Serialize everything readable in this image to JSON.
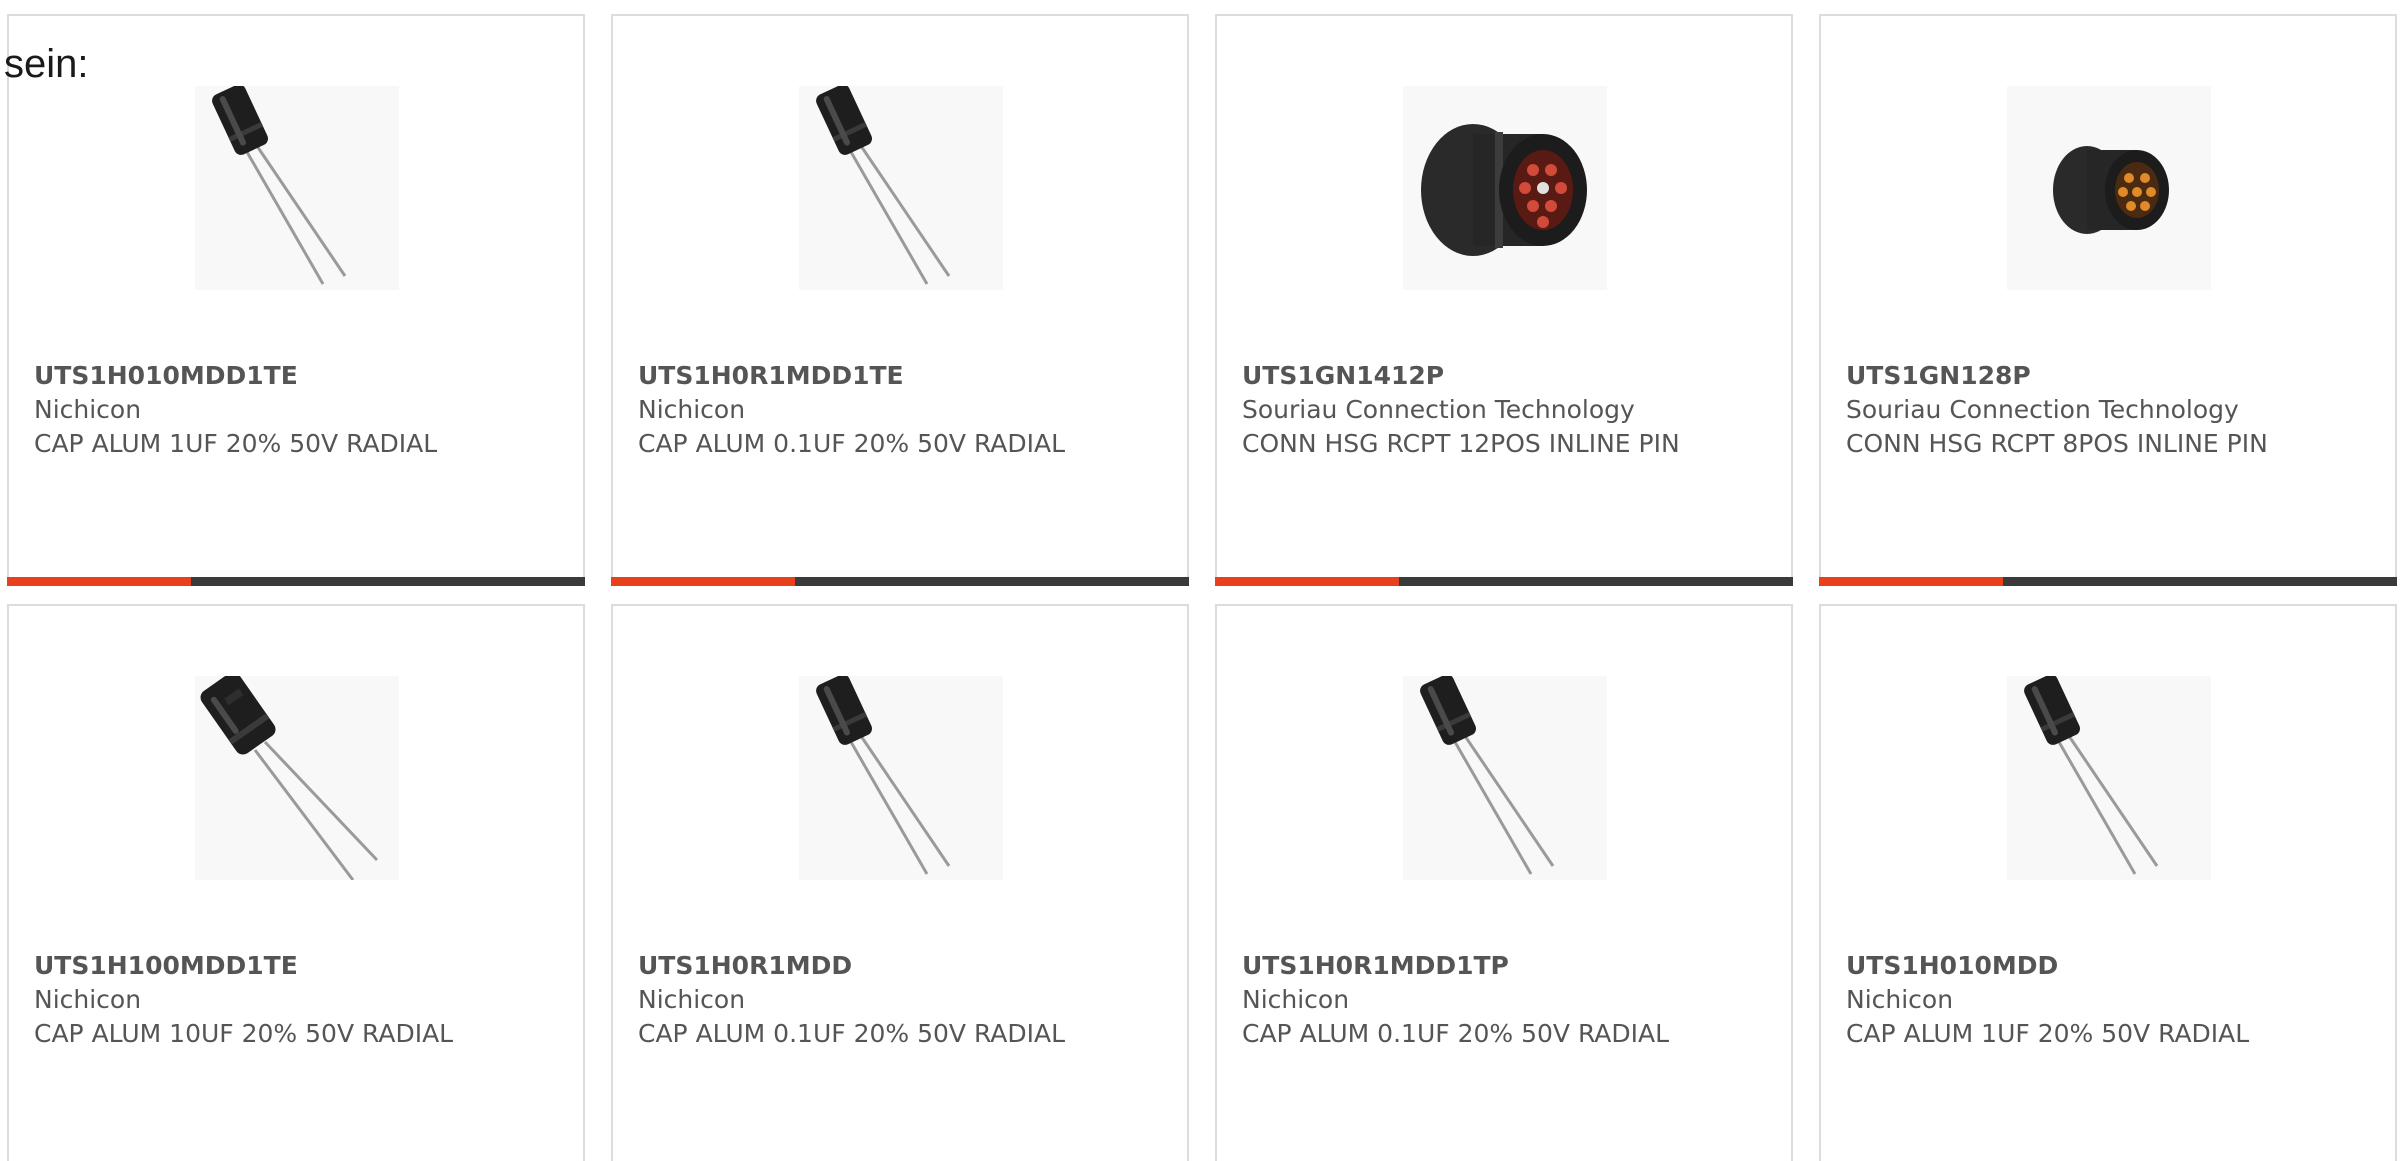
{
  "intro_text": "sein:",
  "colors": {
    "accent": "#e8401c",
    "bar": "#3a3a3a",
    "border": "#dcdcdc",
    "text": "#555555"
  },
  "products": [
    {
      "part_number": "UTS1H010MDD1TE",
      "manufacturer": "Nichicon",
      "description": "CAP ALUM 1UF 20% 50V RADIAL",
      "image_icon": "capacitor-icon"
    },
    {
      "part_number": "UTS1H0R1MDD1TE",
      "manufacturer": "Nichicon",
      "description": "CAP ALUM 0.1UF 20% 50V RADIAL",
      "image_icon": "capacitor-icon"
    },
    {
      "part_number": "UTS1GN1412P",
      "manufacturer": "Souriau Connection Technology",
      "description": "CONN HSG RCPT 12POS INLINE PIN",
      "image_icon": "connector-icon"
    },
    {
      "part_number": "UTS1GN128P",
      "manufacturer": "Souriau Connection Technology",
      "description": "CONN HSG RCPT 8POS INLINE PIN",
      "image_icon": "connector-icon"
    },
    {
      "part_number": "UTS1H100MDD1TE",
      "manufacturer": "Nichicon",
      "description": "CAP ALUM 10UF 20% 50V RADIAL",
      "image_icon": "capacitor-icon"
    },
    {
      "part_number": "UTS1H0R1MDD",
      "manufacturer": "Nichicon",
      "description": "CAP ALUM 0.1UF 20% 50V RADIAL",
      "image_icon": "capacitor-icon"
    },
    {
      "part_number": "UTS1H0R1MDD1TP",
      "manufacturer": "Nichicon",
      "description": "CAP ALUM 0.1UF 20% 50V RADIAL",
      "image_icon": "capacitor-icon"
    },
    {
      "part_number": "UTS1H010MDD",
      "manufacturer": "Nichicon",
      "description": "CAP ALUM 1UF 20% 50V RADIAL",
      "image_icon": "capacitor-icon"
    }
  ]
}
